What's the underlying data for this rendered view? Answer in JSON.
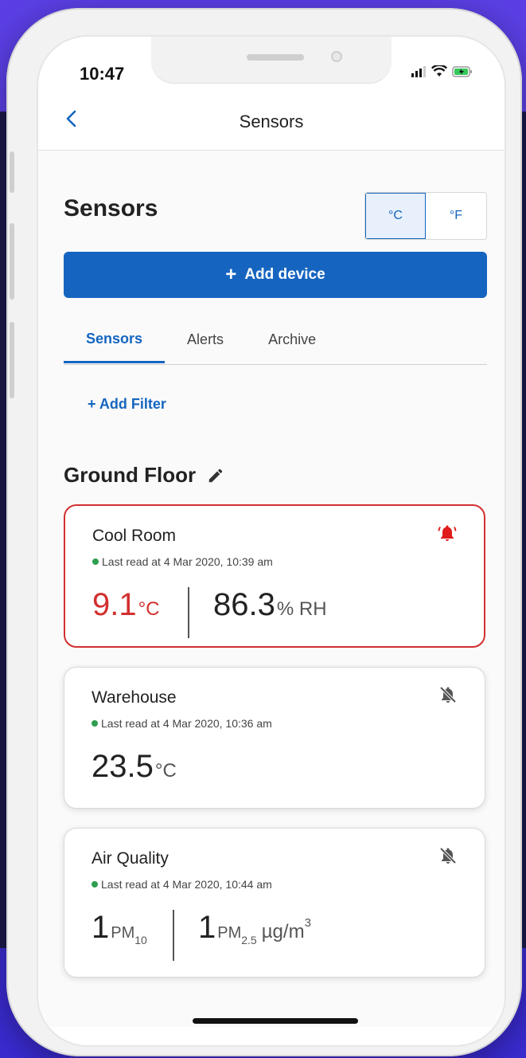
{
  "status_bar": {
    "time": "10:47"
  },
  "nav": {
    "back_glyph": "‹",
    "title": "Sensors"
  },
  "page": {
    "heading": "Sensors",
    "unit_toggle": {
      "celsius": "°C",
      "fahrenheit": "°F",
      "selected": "°C"
    },
    "add_device_label": "Add device",
    "tabs": [
      {
        "label": "Sensors",
        "active": true
      },
      {
        "label": "Alerts",
        "active": false
      },
      {
        "label": "Archive",
        "active": false
      }
    ],
    "add_filter_label": "+ Add Filter",
    "group_title": "Ground Floor"
  },
  "cards": [
    {
      "name": "Cool Room",
      "last_read": "Last read at 4 Mar 2020, 10:39 am",
      "alert": true,
      "temp_value": "9.1",
      "temp_unit": "°C",
      "humidity_value": "86.3",
      "humidity_unit": "% RH",
      "bell_icon": "bell-ringing-icon"
    },
    {
      "name": "Warehouse",
      "last_read": "Last read at 4 Mar 2020, 10:36 am",
      "alert": false,
      "temp_value": "23.5",
      "temp_unit": "°C",
      "bell_icon": "bell-off-icon"
    },
    {
      "name": "Air Quality",
      "last_read": "Last read at 4 Mar 2020, 10:44 am",
      "alert": false,
      "pm10_value": "1",
      "pm10_label": "PM",
      "pm10_sub": "10",
      "pm25_value": "1",
      "pm25_label": "PM",
      "pm25_sub": "2.5",
      "density_unit": "µg/m",
      "density_exp": "3",
      "bell_icon": "bell-off-icon"
    }
  ],
  "colors": {
    "accent": "#1565c0",
    "alert": "#d32f2f",
    "online": "#2e9e4f",
    "background": "#5b3fe4"
  }
}
